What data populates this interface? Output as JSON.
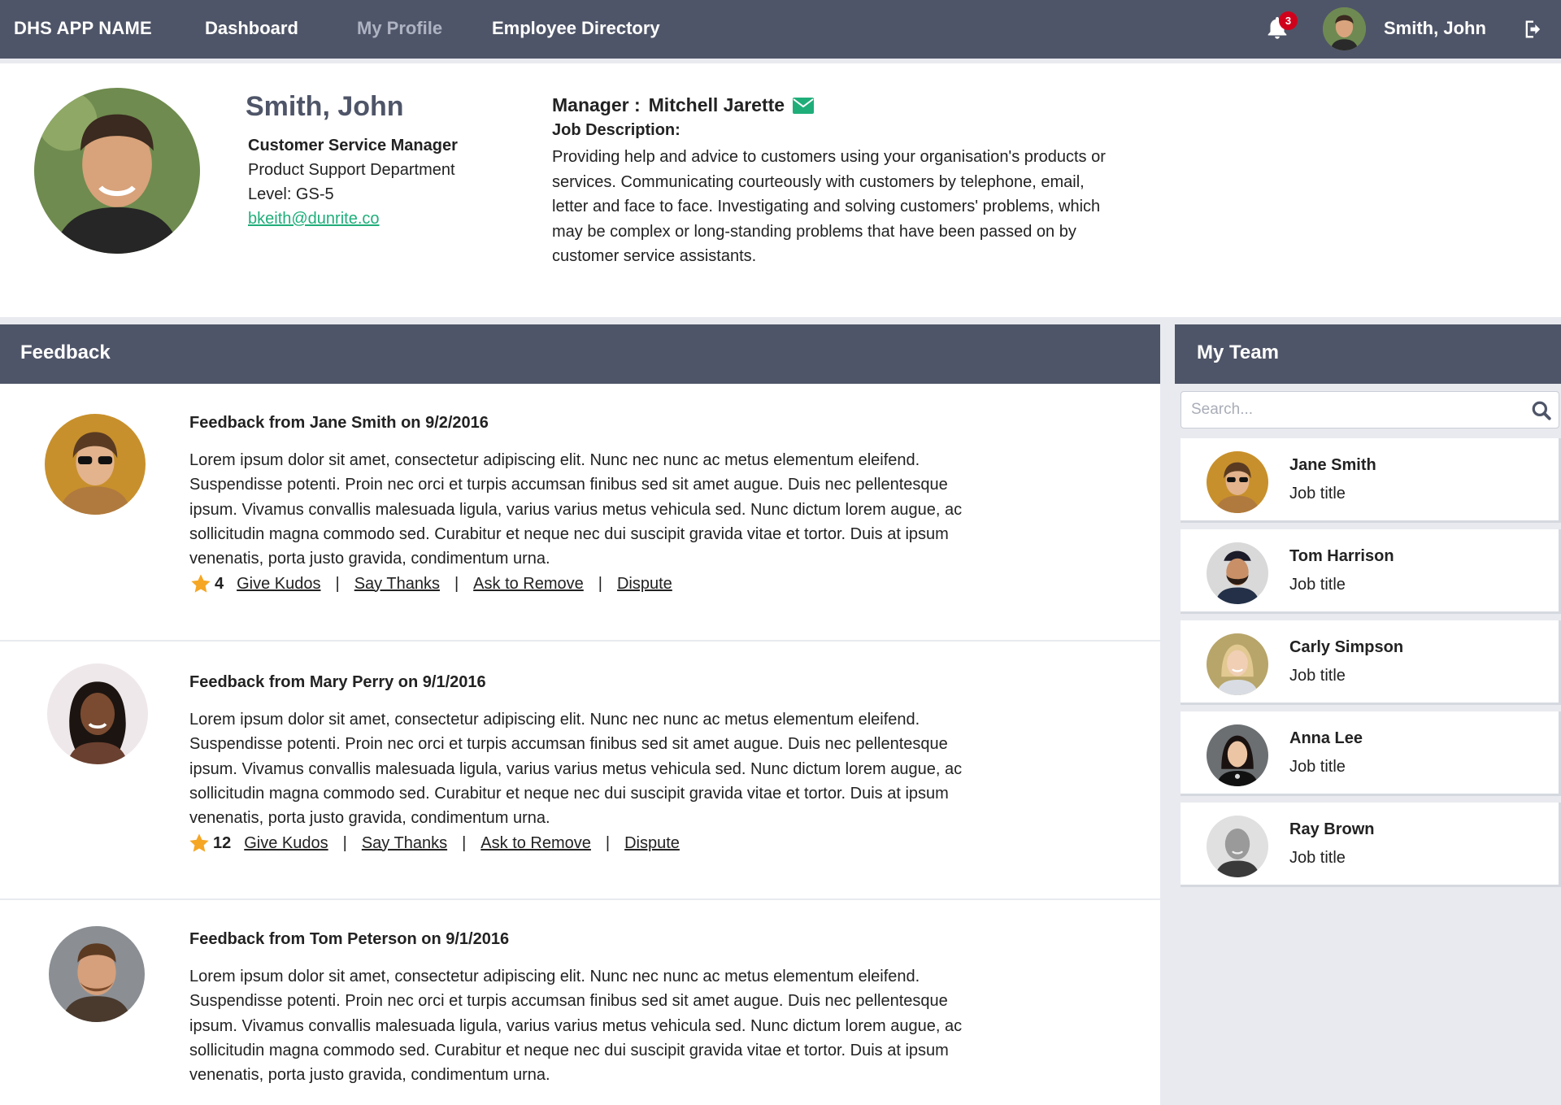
{
  "app": {
    "name": "DHS APP NAME"
  },
  "nav": {
    "items": [
      {
        "label": "Dashboard"
      },
      {
        "label": "My Profile"
      },
      {
        "label": "Employee Directory"
      }
    ],
    "notifications_count": "3",
    "user_name": "Smith, John"
  },
  "profile": {
    "name": "Smith, John",
    "title": "Customer Service Manager",
    "department": "Product Support Department",
    "level": "Level: GS-5",
    "email": "bkeith@dunrite.co",
    "manager_label": "Manager :",
    "manager_name": "Mitchell Jarette",
    "job_description_label": "Job Description:",
    "job_description": "Providing help and advice to customers using your organisation's products or services.  Communicating courteously with customers by telephone, email, letter and face to face.  Investigating and solving customers' problems, which may be complex or long-standing problems that have been passed on by customer service assistants."
  },
  "feedback": {
    "title": "Feedback",
    "actions": {
      "give_kudos": "Give Kudos",
      "say_thanks": "Say Thanks",
      "ask_to_remove": "Ask to Remove",
      "dispute": "Dispute",
      "separator": "|"
    },
    "items": [
      {
        "heading": "Feedback from Jane Smith on 9/2/2016",
        "body": "Lorem ipsum dolor sit amet, consectetur adipiscing elit. Nunc nec nunc ac metus elementum eleifend. Suspendisse potenti. Proin nec orci et turpis accumsan finibus sed sit amet augue. Duis nec pellentesque ipsum. Vivamus convallis malesuada ligula, varius varius metus vehicula sed. Nunc dictum lorem augue, ac sollicitudin magna commodo sed. Curabitur et neque nec dui suscipit gravida vitae et tortor. Duis at ipsum venenatis, porta justo gravida, condimentum urna.",
        "kudos": "4"
      },
      {
        "heading": "Feedback from Mary Perry on 9/1/2016",
        "body": "Lorem ipsum dolor sit amet, consectetur adipiscing elit. Nunc nec nunc ac metus elementum eleifend. Suspendisse potenti. Proin nec orci et turpis accumsan finibus sed sit amet augue. Duis nec pellentesque ipsum. Vivamus convallis malesuada ligula, varius varius metus vehicula sed. Nunc dictum lorem augue, ac sollicitudin magna commodo sed. Curabitur et neque nec dui suscipit gravida vitae et tortor. Duis at ipsum venenatis, porta justo gravida, condimentum urna.",
        "kudos": "12"
      },
      {
        "heading": "Feedback from Tom Peterson on 9/1/2016",
        "body": "Lorem ipsum dolor sit amet, consectetur adipiscing elit. Nunc nec nunc ac metus elementum eleifend. Suspendisse potenti. Proin nec orci et turpis accumsan finibus sed sit amet augue. Duis nec pellentesque ipsum. Vivamus convallis malesuada ligula, varius varius metus vehicula sed. Nunc dictum lorem augue, ac sollicitudin magna commodo sed. Curabitur et neque nec dui suscipit gravida vitae et tortor. Duis at ipsum venenatis, porta justo gravida, condimentum urna."
      }
    ]
  },
  "team": {
    "title": "My Team",
    "search_placeholder": "Search...",
    "members": [
      {
        "name": "Jane Smith",
        "title": "Job title"
      },
      {
        "name": "Tom Harrison",
        "title": "Job title"
      },
      {
        "name": "Carly Simpson",
        "title": "Job title"
      },
      {
        "name": "Anna Lee",
        "title": "Job title"
      },
      {
        "name": "Ray Brown",
        "title": "Job title"
      }
    ]
  },
  "colors": {
    "nav_bg": "#4f5568",
    "accent_green": "#1fae7a",
    "badge_red": "#d0021b",
    "star": "#f5a623",
    "page_bg": "#e8eaef"
  },
  "icons": {
    "bell": "bell-icon",
    "logout": "logout-icon",
    "mail": "mail-icon",
    "search": "search-icon",
    "star": "star-icon"
  }
}
